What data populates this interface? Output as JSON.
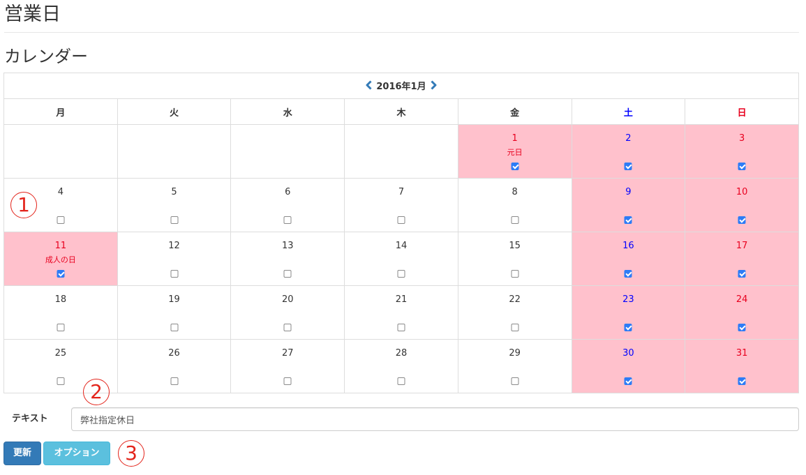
{
  "page": {
    "title": "営業日",
    "section": "カレンダー"
  },
  "calendar": {
    "month_label": "2016年1月",
    "weekdays": [
      {
        "label": "月",
        "color": "#333333"
      },
      {
        "label": "火",
        "color": "#333333"
      },
      {
        "label": "水",
        "color": "#333333"
      },
      {
        "label": "木",
        "color": "#333333"
      },
      {
        "label": "金",
        "color": "#333333"
      },
      {
        "label": "土",
        "color": "#0000ff"
      },
      {
        "label": "日",
        "color": "#e8001e"
      }
    ],
    "weeks": [
      [
        null,
        null,
        null,
        null,
        {
          "day": "1",
          "holiday": "元日",
          "checked": true,
          "kind": "hol"
        },
        {
          "day": "2",
          "checked": true,
          "kind": "sat"
        },
        {
          "day": "3",
          "checked": true,
          "kind": "sun"
        }
      ],
      [
        {
          "day": "4",
          "checked": false
        },
        {
          "day": "5",
          "checked": false
        },
        {
          "day": "6",
          "checked": false
        },
        {
          "day": "7",
          "checked": false
        },
        {
          "day": "8",
          "checked": false
        },
        {
          "day": "9",
          "checked": true,
          "kind": "sat"
        },
        {
          "day": "10",
          "checked": true,
          "kind": "sun"
        }
      ],
      [
        {
          "day": "11",
          "holiday": "成人の日",
          "checked": true,
          "kind": "hol"
        },
        {
          "day": "12",
          "checked": false
        },
        {
          "day": "13",
          "checked": false
        },
        {
          "day": "14",
          "checked": false
        },
        {
          "day": "15",
          "checked": false
        },
        {
          "day": "16",
          "checked": true,
          "kind": "sat"
        },
        {
          "day": "17",
          "checked": true,
          "kind": "sun"
        }
      ],
      [
        {
          "day": "18",
          "checked": false
        },
        {
          "day": "19",
          "checked": false
        },
        {
          "day": "20",
          "checked": false
        },
        {
          "day": "21",
          "checked": false
        },
        {
          "day": "22",
          "checked": false
        },
        {
          "day": "23",
          "checked": true,
          "kind": "sat"
        },
        {
          "day": "24",
          "checked": true,
          "kind": "sun"
        }
      ],
      [
        {
          "day": "25",
          "checked": false
        },
        {
          "day": "26",
          "checked": false
        },
        {
          "day": "27",
          "checked": false
        },
        {
          "day": "28",
          "checked": false
        },
        {
          "day": "29",
          "checked": false
        },
        {
          "day": "30",
          "checked": true,
          "kind": "sat"
        },
        {
          "day": "31",
          "checked": true,
          "kind": "sun"
        }
      ]
    ],
    "colors": {
      "off_day_bg": "#ffc1cc",
      "saturday": "#0000ff",
      "sunday_holiday": "#e8001e",
      "checkbox_on": "#2d7cf6"
    }
  },
  "markers": {
    "m1": "1",
    "m2": "2",
    "m3": "3"
  },
  "form": {
    "text_label": "テキスト",
    "text_value": "弊社指定休日"
  },
  "buttons": {
    "update": "更新",
    "option": "オプション"
  },
  "colors": {
    "btn_primary": "#337ab7",
    "btn_info": "#5bc0de",
    "marker": "#e3241b"
  }
}
